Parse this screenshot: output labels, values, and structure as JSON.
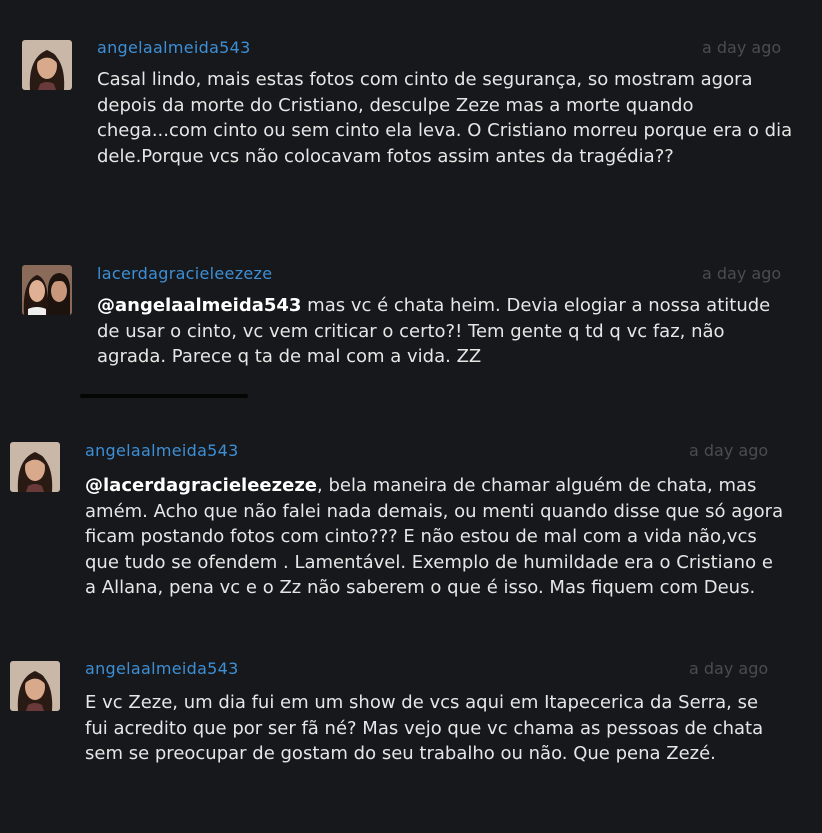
{
  "comments": [
    {
      "username": "angelaalmeida543",
      "time": "a day ago",
      "text": "Casal lindo, mais estas fotos com cinto de segurança, so mostram agora depois da morte do Cristiano, desculpe Zeze mas a morte quando chega...com cinto ou sem cinto ela leva. O Cristiano morreu porque era o dia dele.Porque vcs não colocavam fotos assim antes da tragédia??"
    },
    {
      "username": "lacerdagracieleezeze",
      "time": "a day ago",
      "mention": "@angelaalmeida543",
      "text": " mas vc é chata heim. Devia elogiar a nossa atitude de usar o cinto, vc vem criticar o certo?! Tem gente q td q vc faz, não agrada. Parece q ta de mal com a vida. ZZ"
    },
    {
      "username": "angelaalmeida543",
      "time": "a day ago",
      "mention": "@lacerdagracieleezeze",
      "text": ", bela maneira de chamar alguém de chata, mas amém. Acho que não falei nada demais, ou menti quando disse que só agora ficam postando fotos com cinto??? E não estou de mal com a vida não,vcs que tudo se ofendem . Lamentável. Exemplo de humildade era o Cristiano e a Allana, pena vc e o Zz não saberem o que é isso. Mas fiquem com Deus."
    },
    {
      "username": "angelaalmeida543",
      "time": "a day ago",
      "text": "E vc Zeze, um dia fui em um show de vcs aqui em Itapecerica da Serra, se fui acredito que por ser fã né? Mas vejo que vc chama as pessoas de chata sem se preocupar de gostam do seu trabalho ou não. Que pena Zezé."
    }
  ]
}
